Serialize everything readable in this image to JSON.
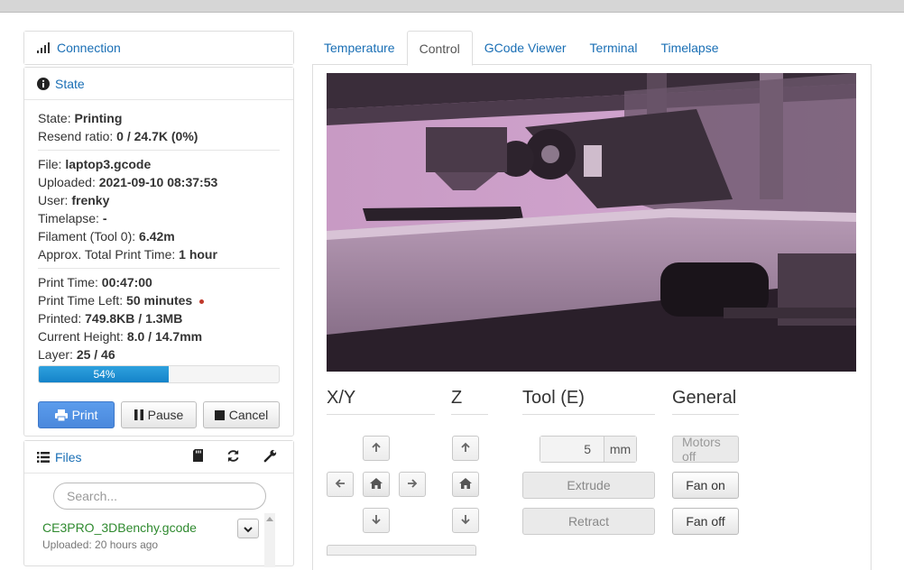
{
  "sidebar": {
    "connection": {
      "label": "Connection",
      "icon": "signal-icon"
    },
    "state": {
      "label": "State",
      "icon": "info-icon",
      "state_label": "State:",
      "state_value": "Printing",
      "resend_label": "Resend ratio:",
      "resend_value": "0 / 24.7K (0%)",
      "file_label": "File:",
      "file_value": "laptop3.gcode",
      "uploaded_label": "Uploaded:",
      "uploaded_value": "2021-09-10 08:37:53",
      "user_label": "User:",
      "user_value": "frenky",
      "timelapse_label": "Timelapse:",
      "timelapse_value": "-",
      "filament_label": "Filament (Tool 0):",
      "filament_value": "6.42m",
      "approx_label": "Approx. Total Print Time:",
      "approx_value": "1 hour",
      "print_time_label": "Print Time:",
      "print_time_value": "00:47:00",
      "time_left_label": "Print Time Left:",
      "time_left_value": "50 minutes",
      "printed_label": "Printed:",
      "printed_value": "749.8KB / 1.3MB",
      "height_label": "Current Height:",
      "height_value": "8.0 / 14.7mm",
      "layer_label": "Layer:",
      "layer_value": "25 / 46",
      "progress_text": "54%",
      "progress_fraction": 0.54,
      "buttons": {
        "print": "Print",
        "pause": "Pause",
        "cancel": "Cancel"
      }
    },
    "files": {
      "label": "Files",
      "search_placeholder": "Search...",
      "items": [
        {
          "name": "CE3PRO_3DBenchy.gcode",
          "meta": "Uploaded: 20 hours ago"
        }
      ]
    }
  },
  "tabs": [
    "Temperature",
    "Control",
    "GCode Viewer",
    "Terminal",
    "Timelapse"
  ],
  "active_tab": "Control",
  "control": {
    "xy_title": "X/Y",
    "z_title": "Z",
    "tool_title": "Tool (E)",
    "general_title": "General",
    "extrude_amount": "5",
    "extrude_unit": "mm",
    "extrude_label": "Extrude",
    "retract_label": "Retract",
    "motors_off_label": "Motors off",
    "fan_on_label": "Fan on",
    "fan_off_label": "Fan off"
  },
  "colors": {
    "link": "#1a6fb5",
    "progress": "#1583c9",
    "primary_button": "#4a88dc",
    "status_dot": "#c0392b"
  }
}
